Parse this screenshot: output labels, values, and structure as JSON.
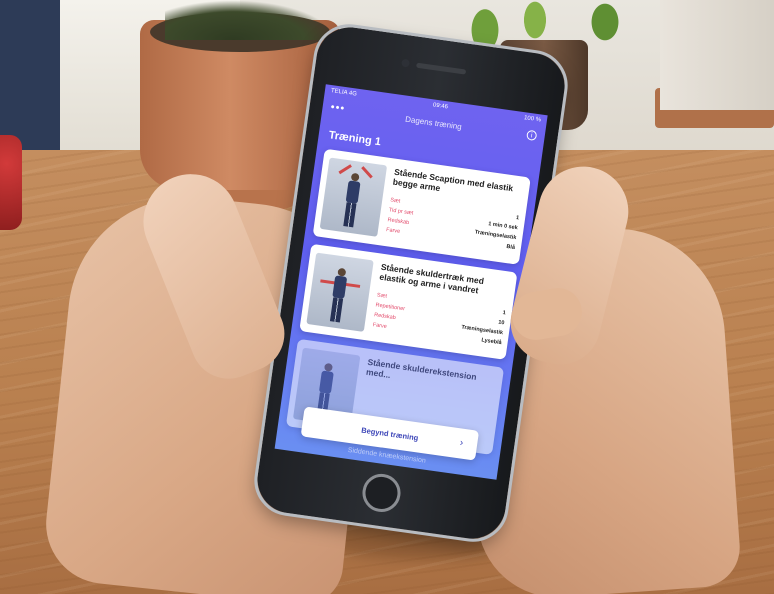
{
  "status_bar": {
    "carrier": "TELIA  4G",
    "time": "09:46",
    "battery": "100 %"
  },
  "nav": {
    "menu_icon": "more-icon",
    "title": "Dagens træning",
    "info_icon": "info-icon"
  },
  "section_title": "Træning 1",
  "cards": [
    {
      "title": "Stående Scaption med elastik begge arme",
      "rows": [
        {
          "key": "Sæt",
          "value": "1"
        },
        {
          "key": "Tid pr sæt",
          "value": "1 min 0 sek"
        },
        {
          "key": "Redskab",
          "value": "Træningselastik"
        },
        {
          "key": "Farve",
          "value": "Blå"
        }
      ]
    },
    {
      "title": "Stående skuldertræk med elastik og arme i vandret",
      "rows": [
        {
          "key": "Sæt",
          "value": "1"
        },
        {
          "key": "Repetitioner",
          "value": "10"
        },
        {
          "key": "Redskab",
          "value": "Træningselastik"
        },
        {
          "key": "Farve",
          "value": "Lyseblå"
        }
      ]
    },
    {
      "title": "Stående skulderekstension med..."
    }
  ],
  "cta": {
    "label": "Begynd træning",
    "chevron": "›"
  },
  "bottom_peek": "Siddende knæekstension"
}
